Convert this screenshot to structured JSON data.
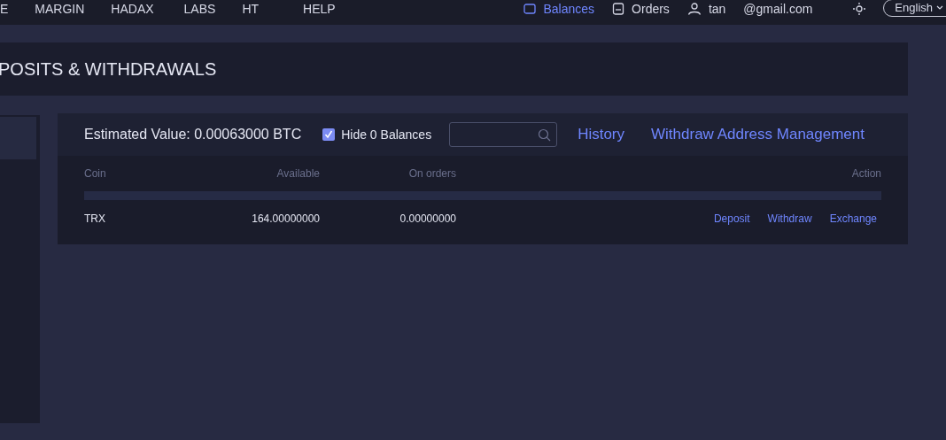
{
  "nav": {
    "menu": [
      {
        "label": "E"
      },
      {
        "label": "MARGIN"
      },
      {
        "label": "HADAX"
      },
      {
        "label": "LABS"
      },
      {
        "label": "HT"
      },
      {
        "label": "HELP"
      }
    ],
    "right": [
      {
        "kind": "balances",
        "label": "Balances",
        "selected": true
      },
      {
        "kind": "orders",
        "label": "Orders",
        "selected": false
      },
      {
        "kind": "user",
        "label": "tan",
        "selected": false
      },
      {
        "kind": "email",
        "label": "@gmail.com",
        "selected": false
      }
    ],
    "language": "English"
  },
  "page_title": "POSITS & WITHDRAWALS",
  "sidebar": {
    "items": [
      {
        "selected": true
      }
    ]
  },
  "balances": {
    "estimated_value": "Estimated Value: 0.00063000 BTC",
    "hide_zero": {
      "label": "Hide 0 Balances",
      "checked": true
    },
    "links": [
      "History",
      "Withdraw Address Management"
    ],
    "table": {
      "columns": [
        "Coin",
        "Available",
        "On orders",
        "Action"
      ],
      "rows": [
        {
          "coin": "TRX",
          "available": "164.00000000",
          "on_orders": "0.00000000",
          "actions": [
            "Deposit",
            "Withdraw",
            "Exchange"
          ]
        }
      ]
    }
  }
}
